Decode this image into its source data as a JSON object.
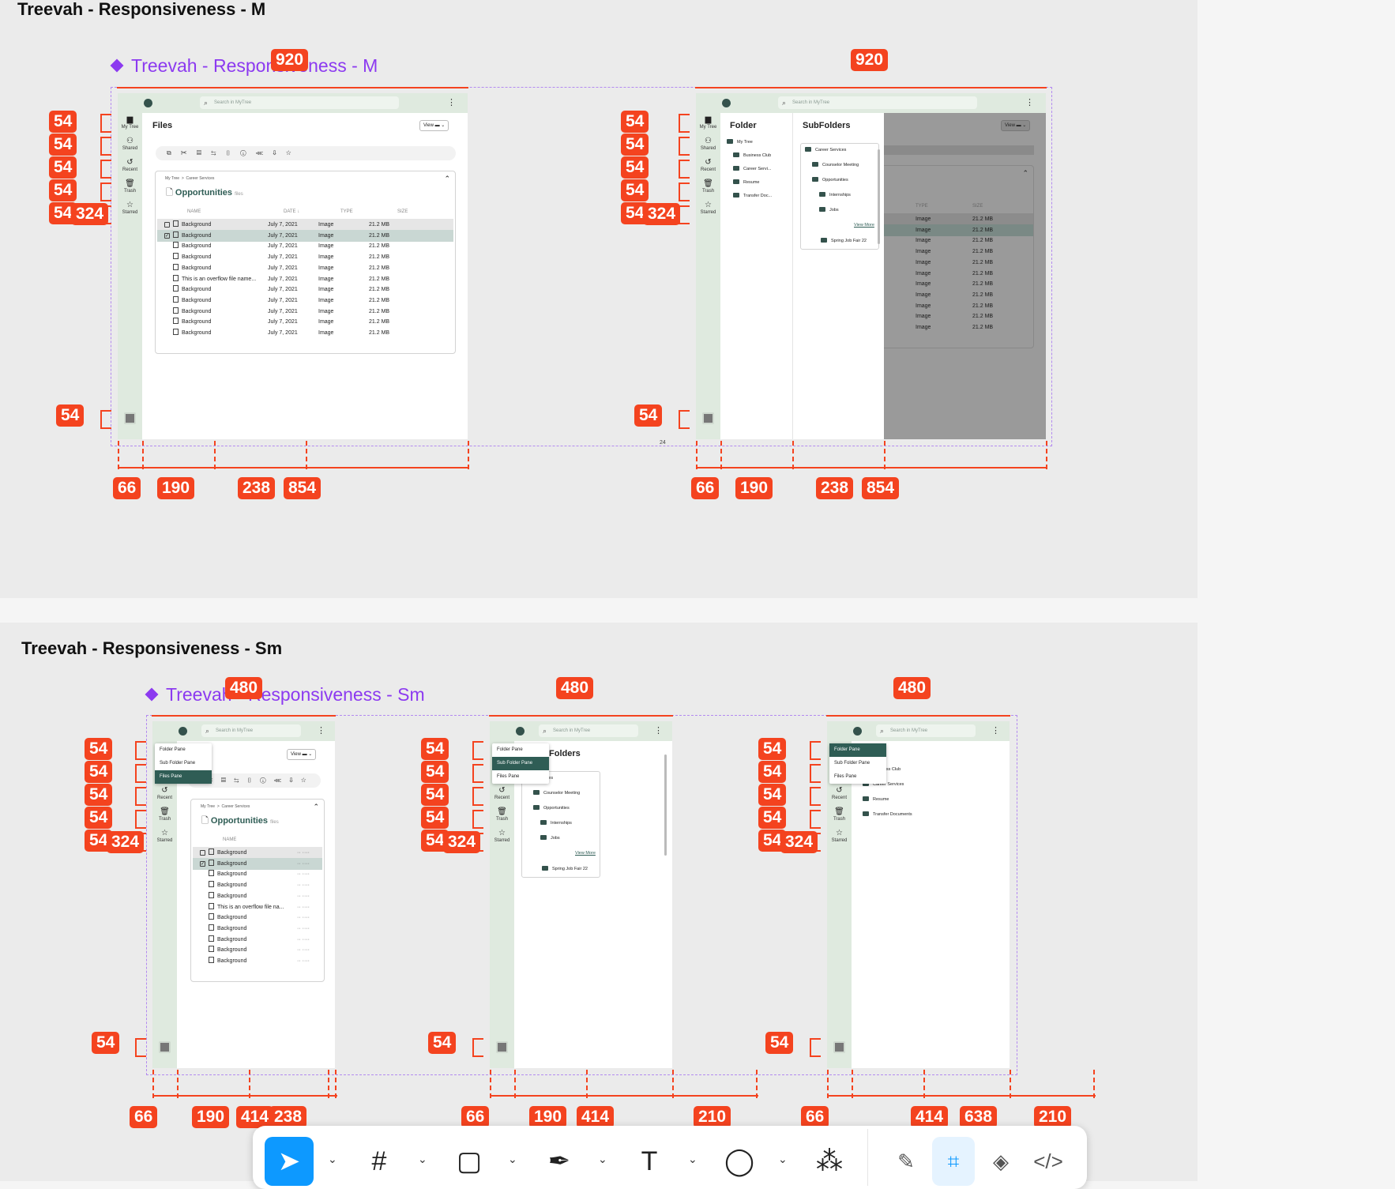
{
  "section_m": {
    "title": "Treevah - Responsiveness - M",
    "component_title": "Treevah - Responsiveness - M",
    "width_label": "920",
    "row_labels": [
      "54",
      "54",
      "54",
      "54",
      "54"
    ],
    "overlap_label": "324",
    "bottom_label": "54",
    "col_labels": [
      "66",
      "190",
      "238",
      "854"
    ],
    "gap_label": "24"
  },
  "section_sm": {
    "title": "Treevah - Responsiveness - Sm",
    "component_title": "Treevah - Responsiveness - Sm",
    "width_label": "480",
    "row_labels": [
      "54",
      "54",
      "54",
      "54",
      "54"
    ],
    "overlap_label": "324",
    "bottom_label": "54",
    "col_labels_a": [
      "66",
      "190",
      "414",
      "238"
    ],
    "col_labels_b": [
      "66",
      "190",
      "414",
      "210"
    ],
    "col_labels_c": [
      "66",
      "414",
      "638",
      "210"
    ]
  },
  "app": {
    "search_placeholder": "Search in MyTree",
    "rail": [
      {
        "icon": "folder-icon",
        "glyph": "▆",
        "label": "My Tree"
      },
      {
        "icon": "shared-icon",
        "glyph": "⚇",
        "label": "Shared"
      },
      {
        "icon": "recent-icon",
        "glyph": "↺",
        "label": "Recent"
      },
      {
        "icon": "trash-icon",
        "glyph": "🗑",
        "label": "Trash"
      },
      {
        "icon": "star-icon",
        "glyph": "☆",
        "label": "Starred"
      }
    ],
    "files_title": "Files",
    "view_label": "View",
    "toolbar_glyphs": "⧉ ✂ ▤ ⇆ ▯ ⓘ ⋘ ⇩ ☆",
    "crumb": [
      "My Tree",
      ">",
      "Career Services"
    ],
    "card_title": "Opportunities",
    "card_sub": "files",
    "columns": [
      "NAME",
      "DATE ↓",
      "TYPE",
      "SIZE"
    ],
    "rows": [
      {
        "name": "Background",
        "date": "July 7, 2021",
        "type": "Image",
        "size": "21.2 MB"
      },
      {
        "name": "Background",
        "date": "July 7, 2021",
        "type": "Image",
        "size": "21.2 MB"
      },
      {
        "name": "Background",
        "date": "July 7, 2021",
        "type": "Image",
        "size": "21.2 MB"
      },
      {
        "name": "Background",
        "date": "July 7, 2021",
        "type": "Image",
        "size": "21.2 MB"
      },
      {
        "name": "Background",
        "date": "July 7, 2021",
        "type": "Image",
        "size": "21.2 MB"
      },
      {
        "name": "This is an overflow file name...",
        "date": "July 7, 2021",
        "type": "Image",
        "size": "21.2 MB"
      },
      {
        "name": "Background",
        "date": "July 7, 2021",
        "type": "Image",
        "size": "21.2 MB"
      },
      {
        "name": "Background",
        "date": "July 7, 2021",
        "type": "Image",
        "size": "21.2 MB"
      },
      {
        "name": "Background",
        "date": "July 7, 2021",
        "type": "Image",
        "size": "21.2 MB"
      },
      {
        "name": "Background",
        "date": "July 7, 2021",
        "type": "Image",
        "size": "21.2 MB"
      },
      {
        "name": "Background",
        "date": "July 7, 2021",
        "type": "Image",
        "size": "21.2 MB"
      }
    ],
    "sm_rows": [
      "Background",
      "Background",
      "Background",
      "Background",
      "Background",
      "This is an overflow file na...",
      "Background",
      "Background",
      "Background",
      "Background",
      "Background"
    ],
    "folder_title": "Folder",
    "subfolder_title": "SubFolders",
    "sm_subfolder_title": "Folders",
    "folders": [
      "My Tree",
      "Business Club",
      "Career Servi...",
      "Resume",
      "Transfer Doc..."
    ],
    "folders_full": [
      "Business Club",
      "Career Services",
      "Resume",
      "Transfer Documents"
    ],
    "subfolders": [
      "Career Services",
      "Counselor Meeting",
      "Opportunities",
      "Internships",
      "Jobs"
    ],
    "sm_subfolders": [
      "Services",
      "Counselor Meeting",
      "Opportunities",
      "Internships",
      "Jobs"
    ],
    "view_more": "View More",
    "subfolder_extra": "Spring Job Fair 22",
    "pane_menu": [
      "Folder Pane",
      "Sub Folder Pane",
      "Files Pane"
    ]
  },
  "toolbar": {
    "tools": [
      {
        "name": "move-tool",
        "glyph": "➤",
        "active": true
      },
      {
        "name": "frame-tool",
        "glyph": "#"
      },
      {
        "name": "rectangle-tool",
        "glyph": "▢"
      },
      {
        "name": "pen-tool",
        "glyph": "✒"
      },
      {
        "name": "text-tool",
        "glyph": "T"
      },
      {
        "name": "comment-tool",
        "glyph": "◯"
      },
      {
        "name": "actions-tool",
        "glyph": "⁂"
      }
    ],
    "modes": [
      {
        "name": "draw-mode",
        "glyph": "✎"
      },
      {
        "name": "design-mode",
        "glyph": "⌗",
        "active": true
      },
      {
        "name": "prototype-mode",
        "glyph": "◈"
      },
      {
        "name": "dev-mode",
        "glyph": "</>"
      }
    ]
  },
  "colors": {
    "annotation": "#f4431f",
    "component": "#8c3af0",
    "brand": "#2f5d55",
    "rail": "#dfeadf",
    "active_tool": "#0d99ff"
  }
}
